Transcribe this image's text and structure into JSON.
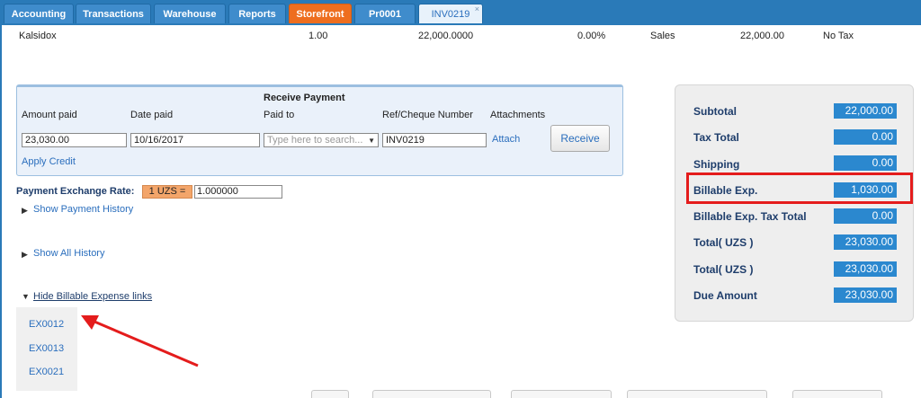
{
  "tabs": [
    {
      "label": "Accounting"
    },
    {
      "label": "Transactions"
    },
    {
      "label": "Warehouse"
    },
    {
      "label": "Reports"
    },
    {
      "label": "Storefront"
    },
    {
      "label": "Pr0001"
    },
    {
      "label": "INV0219",
      "close": "×"
    }
  ],
  "line_item": {
    "name": "Kalsidox",
    "qty": "1.00",
    "price": "22,000.0000",
    "discount": "0.00%",
    "account": "Sales",
    "amount": "22,000.00",
    "tax": "No Tax"
  },
  "receive_payment": {
    "title": "Receive Payment",
    "labels": {
      "amount_paid": "Amount paid",
      "date_paid": "Date paid",
      "paid_to": "Paid to",
      "ref": "Ref/Cheque Number",
      "attachments": "Attachments"
    },
    "amount_paid": "23,030.00",
    "date_paid": "10/16/2017",
    "paid_to_placeholder": "Type here to search...",
    "ref_number": "INV0219",
    "attach_link": "Attach",
    "receive_button": "Receive",
    "apply_credit": "Apply Credit"
  },
  "exchange": {
    "label": "Payment Exchange Rate:",
    "badge": "1 UZS =",
    "rate": "1.000000"
  },
  "history": {
    "show_payment_history": "Show Payment History",
    "show_all_history": "Show All History",
    "hide_billable": "Hide Billable Expense links"
  },
  "billable_links": [
    "EX0012",
    "EX0013",
    "EX0021"
  ],
  "totals": [
    {
      "label": "Subtotal",
      "value": "22,000.00"
    },
    {
      "label": "Tax Total",
      "value": "0.00"
    },
    {
      "label": "Shipping",
      "value": "0.00"
    },
    {
      "label": "Billable Exp.",
      "value": "1,030.00"
    },
    {
      "label": "Billable Exp. Tax Total",
      "value": "0.00"
    },
    {
      "label": "Total( UZS )",
      "value": "23,030.00"
    },
    {
      "label": "Total( UZS )",
      "value": "23,030.00"
    },
    {
      "label": "Due Amount",
      "value": "23,030.00"
    }
  ],
  "colors": {
    "tabbar": "#2a7ab8",
    "storefront_tab": "#ee6e1f",
    "value_box": "#2b88cf",
    "highlight": "#e41c1c"
  }
}
